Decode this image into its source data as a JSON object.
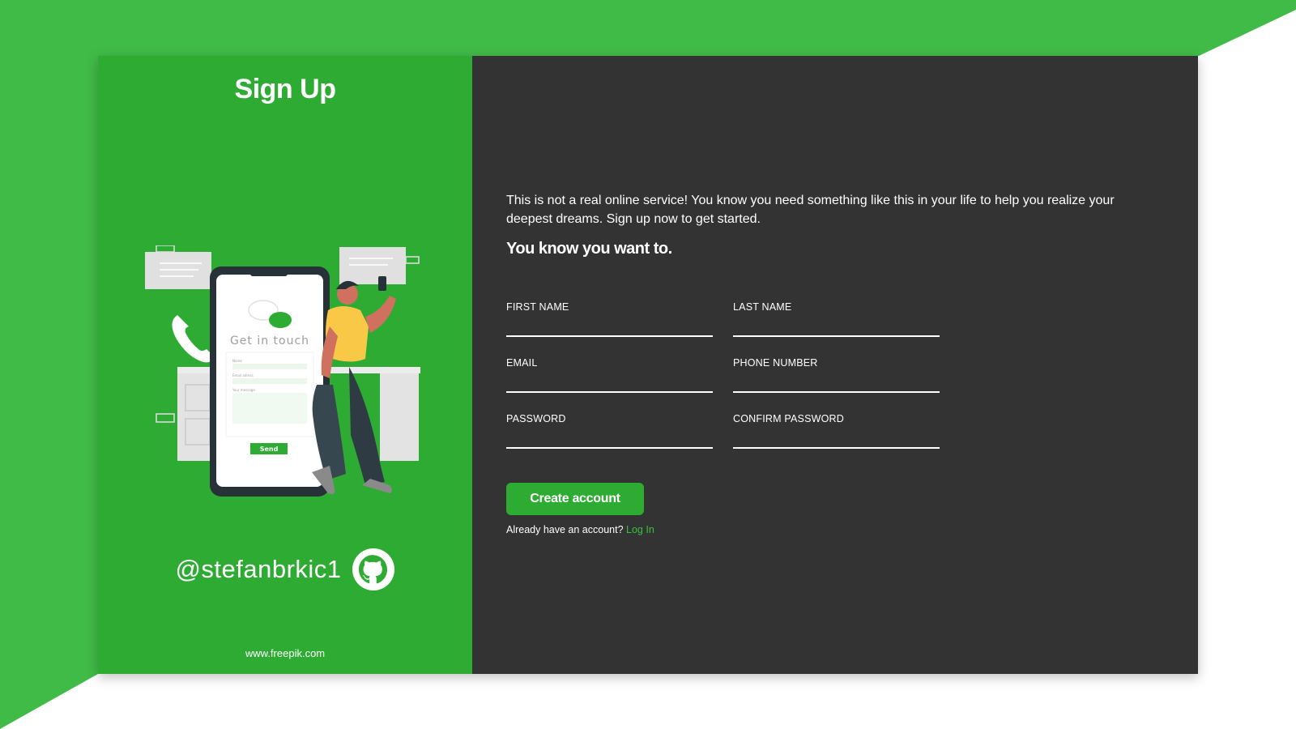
{
  "colors": {
    "brand_green": "#2eab32",
    "bg_green": "#41bb48",
    "panel_dark": "#333333",
    "link_green": "#37c23c"
  },
  "left": {
    "title": "Sign Up",
    "illustration": {
      "heading": "Get in touch",
      "field_name": "Name",
      "field_email": "Email adress",
      "field_message": "Your message",
      "send_label": "Send"
    },
    "handle": "@stefanbrkic1",
    "handle_icon": "github-icon",
    "credit": "www.freepik.com"
  },
  "right": {
    "intro": "This is not a real online service! You know you need something like this in your life to help you realize your deepest dreams. Sign up now to get started.",
    "tagline": "You know you want to.",
    "fields": [
      {
        "label": "FIRST NAME",
        "value": ""
      },
      {
        "label": "LAST NAME",
        "value": ""
      },
      {
        "label": "EMAIL",
        "value": ""
      },
      {
        "label": "PHONE NUMBER",
        "value": ""
      },
      {
        "label": "PASSWORD",
        "value": ""
      },
      {
        "label": "CONFIRM PASSWORD",
        "value": ""
      }
    ],
    "submit_label": "Create account",
    "login_prompt": "Already have an account?",
    "login_link": "Log In"
  }
}
